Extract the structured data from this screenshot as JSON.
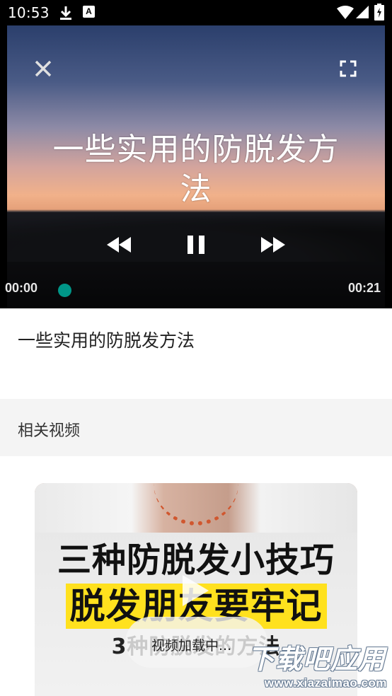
{
  "status_bar": {
    "time": "10:53",
    "icons": [
      "download-icon",
      "a-notification-icon",
      "wifi-icon",
      "signal-icon",
      "battery-icon"
    ]
  },
  "player": {
    "overlay_text_line1": "一些实用的防脱发方",
    "overlay_text_line2": "法",
    "time_current": "00:00",
    "time_total": "00:21",
    "progress_fraction": 0.0,
    "accent_color": "#009688",
    "controls": [
      "close-icon",
      "fullscreen-icon",
      "rewind-icon",
      "pause-icon",
      "fast-forward-icon"
    ]
  },
  "video": {
    "title": "一些实用的防脱发方法"
  },
  "related": {
    "header": "相关视频",
    "card": {
      "line1": "三种防脱发小技巧",
      "line2": "脱发朋友要牢记",
      "line3": "3种防脱发的方法",
      "play_icon": "play-icon"
    }
  },
  "toast": {
    "text": "视频加载中..."
  },
  "watermark": {
    "main": "下载吧应用",
    "sub": "www.xiazaimao.com"
  }
}
